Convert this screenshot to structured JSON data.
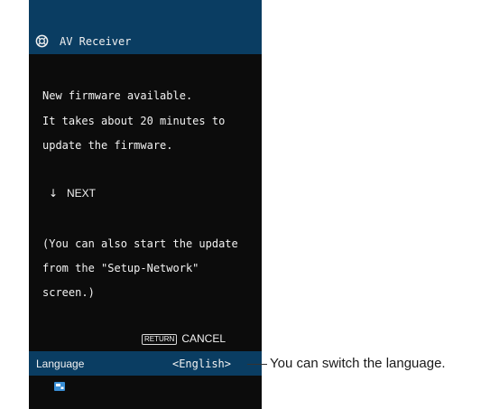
{
  "header": {
    "icon": "network-globe-icon",
    "title": "AV Receiver"
  },
  "message": {
    "line1": "New firmware available.",
    "line2": "It takes about 20 minutes to",
    "line3": "update the firmware."
  },
  "next": {
    "arrow": "↓",
    "label": "NEXT"
  },
  "note": {
    "line1": "(You can also start the update",
    "line2": "from the \"Setup-Network\"",
    "line3": "screen.)"
  },
  "cancel": {
    "key_label": "RETURN",
    "label": "CANCEL"
  },
  "language": {
    "label": "Language",
    "value": "<English>"
  },
  "status_icon": "network-status-icon",
  "annotation": {
    "text": "You can switch the language."
  },
  "colors": {
    "screen_bg": "#0c0c0c",
    "header_bg": "#0a3d62",
    "text": "#f2f2f2"
  }
}
